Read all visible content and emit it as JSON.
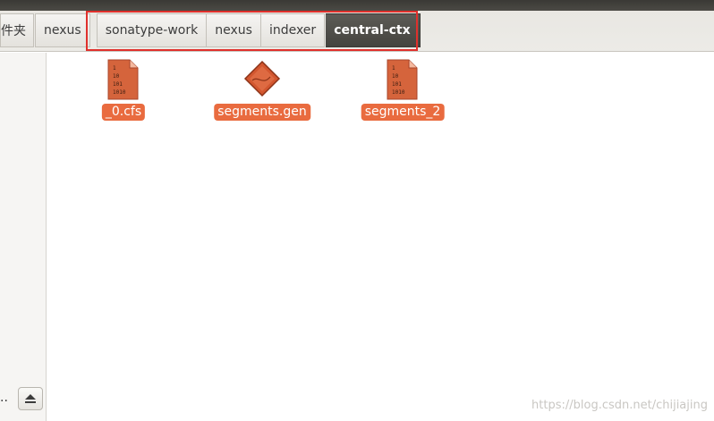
{
  "breadcrumb": {
    "items": [
      {
        "label": "件夹"
      },
      {
        "label": "nexus"
      },
      {
        "label": "sonatype-work"
      },
      {
        "label": "nexus"
      },
      {
        "label": "indexer"
      },
      {
        "label": "central-ctx"
      }
    ]
  },
  "files": [
    {
      "name": "_0.cfs",
      "icon": "binary-file-icon"
    },
    {
      "name": "segments.gen",
      "icon": "diamond-file-icon"
    },
    {
      "name": "segments_2",
      "icon": "binary-file-icon"
    }
  ],
  "sidebar": {
    "ellipsis": "..",
    "eject_icon": "eject-icon"
  },
  "binary_icon_text": [
    "1",
    "10",
    "101",
    "1010"
  ],
  "watermark": "https://blog.csdn.net/chijiajing",
  "colors": {
    "selection": "#e96b3f",
    "highlight_box": "#e0302c",
    "active_crumb": "#4f4e49"
  }
}
